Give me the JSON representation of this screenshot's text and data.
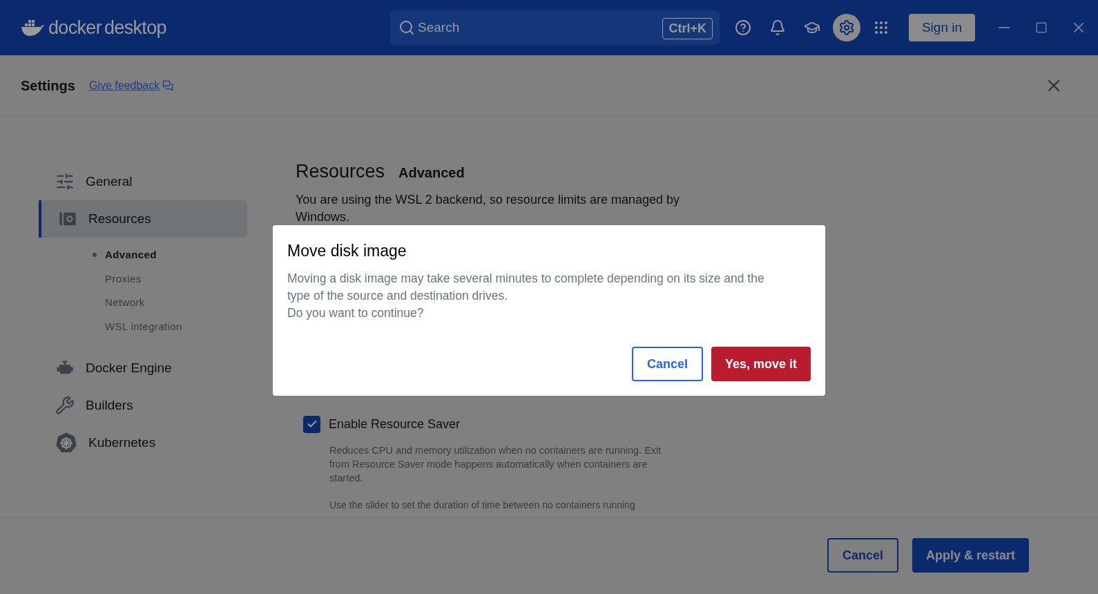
{
  "header": {
    "logo": {
      "brand": "docker",
      "product": "desktop"
    },
    "search": {
      "placeholder": "Search",
      "shortcut": "Ctrl+K"
    },
    "icons": [
      {
        "kind": "help",
        "selected": false
      },
      {
        "kind": "bell",
        "selected": false
      },
      {
        "kind": "learn",
        "selected": false
      },
      {
        "kind": "settings",
        "selected": true
      },
      {
        "kind": "apps",
        "selected": false
      }
    ],
    "sign_in": "Sign in"
  },
  "settings_bar": {
    "title": "Settings",
    "feedback_link": "Give feedback"
  },
  "sidebar": {
    "items": [
      {
        "label": "General",
        "kind": "general",
        "selected": false
      },
      {
        "label": "Resources",
        "kind": "resources",
        "selected": true,
        "children": [
          {
            "label": "Advanced",
            "selected": true
          },
          {
            "label": "Proxies",
            "selected": false
          },
          {
            "label": "Network",
            "selected": false
          },
          {
            "label": "WSL integration",
            "selected": false
          }
        ]
      },
      {
        "label": "Docker Engine",
        "kind": "engine",
        "selected": false
      },
      {
        "label": "Builders",
        "kind": "builders",
        "selected": false
      },
      {
        "label": "Kubernetes",
        "kind": "kubernetes",
        "selected": false
      }
    ]
  },
  "content": {
    "title": "Resources",
    "subtitle": "Advanced",
    "notice": "You are using the WSL 2 backend, so resource limits are managed by Windows.",
    "resource_saver": {
      "label": "Enable Resource Saver",
      "checked": true,
      "description": "Reduces CPU and memory utilization when no containers are running. Exit from Resource Saver mode happens automatically when containers are started.",
      "slider_hint": "Use the slider to set the duration of time between no containers running"
    }
  },
  "footer": {
    "buttons": [
      {
        "label": "Cancel",
        "kind": "secondary"
      },
      {
        "label": "Apply & restart",
        "kind": "primary"
      }
    ]
  },
  "dialog": {
    "title": "Move disk image",
    "message": [
      "Moving a disk image may take several minutes to complete depending on its size and the type of the source and destination drives.",
      "Do you want to continue?"
    ],
    "buttons": [
      {
        "label": "Cancel",
        "kind": "secondary"
      },
      {
        "label": "Yes, move it",
        "kind": "danger"
      }
    ]
  }
}
